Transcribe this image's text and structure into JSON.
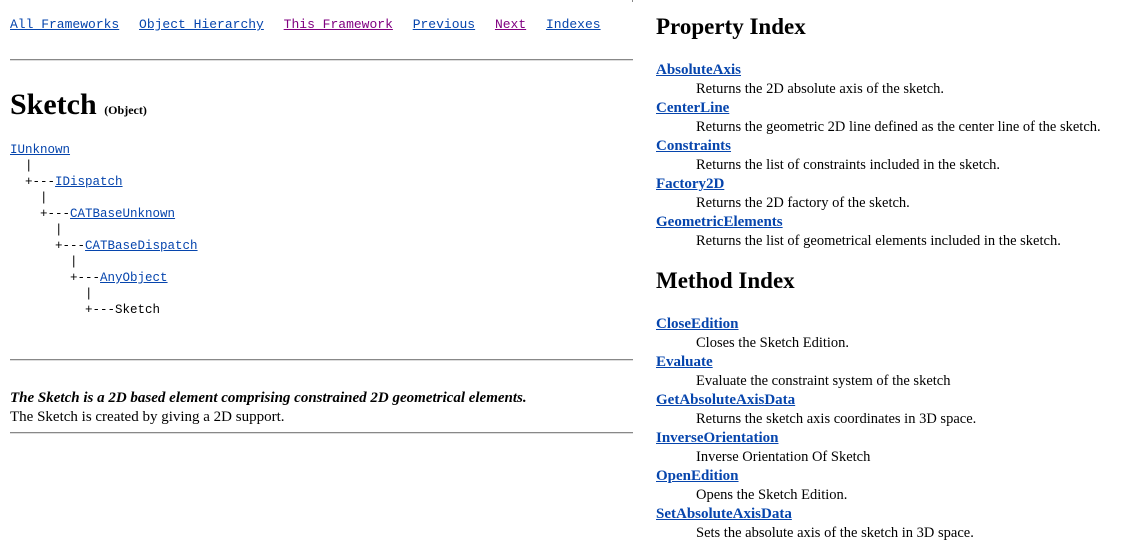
{
  "nav": {
    "links": [
      {
        "label": "All Frameworks",
        "visited": false
      },
      {
        "label": "Object Hierarchy",
        "visited": false
      },
      {
        "label": "This Framework",
        "visited": true
      },
      {
        "label": "Previous",
        "visited": false
      },
      {
        "label": "Next",
        "visited": true
      },
      {
        "label": "Indexes",
        "visited": false
      }
    ]
  },
  "object": {
    "name": "Sketch",
    "kind": "(Object)"
  },
  "hierarchy": {
    "root": "IUnknown",
    "pipe": "|",
    "branch": "+---",
    "levels": [
      "IDispatch",
      "CATBaseUnknown",
      "CATBaseDispatch",
      "AnyObject"
    ],
    "current": "Sketch"
  },
  "description": {
    "lead": "The Sketch is a 2D based element comprising constrained 2D geometrical elements.",
    "body": "The Sketch is created by giving a 2D support."
  },
  "property_index": {
    "title": "Property Index",
    "items": [
      {
        "name": "AbsoluteAxis",
        "text": "Returns the 2D absolute axis of the sketch."
      },
      {
        "name": "CenterLine",
        "text": "Returns the geometric 2D line defined as the center line of the sketch."
      },
      {
        "name": "Constraints",
        "text": "Returns the list of constraints included in the sketch."
      },
      {
        "name": "Factory2D",
        "text": "Returns the 2D factory of the sketch."
      },
      {
        "name": "GeometricElements",
        "text": "Returns the list of geometrical elements included in the sketch."
      }
    ]
  },
  "method_index": {
    "title": "Method Index",
    "items": [
      {
        "name": "CloseEdition",
        "text": "Closes the Sketch Edition."
      },
      {
        "name": "Evaluate",
        "text": "Evaluate the constraint system of the sketch"
      },
      {
        "name": "GetAbsoluteAxisData",
        "text": "Returns the sketch axis coordinates in 3D space."
      },
      {
        "name": "InverseOrientation",
        "text": "Inverse Orientation Of Sketch"
      },
      {
        "name": "OpenEdition",
        "text": "Opens the Sketch Edition."
      },
      {
        "name": "SetAbsoluteAxisData",
        "text": "Sets the absolute axis of the sketch in 3D space."
      }
    ]
  }
}
